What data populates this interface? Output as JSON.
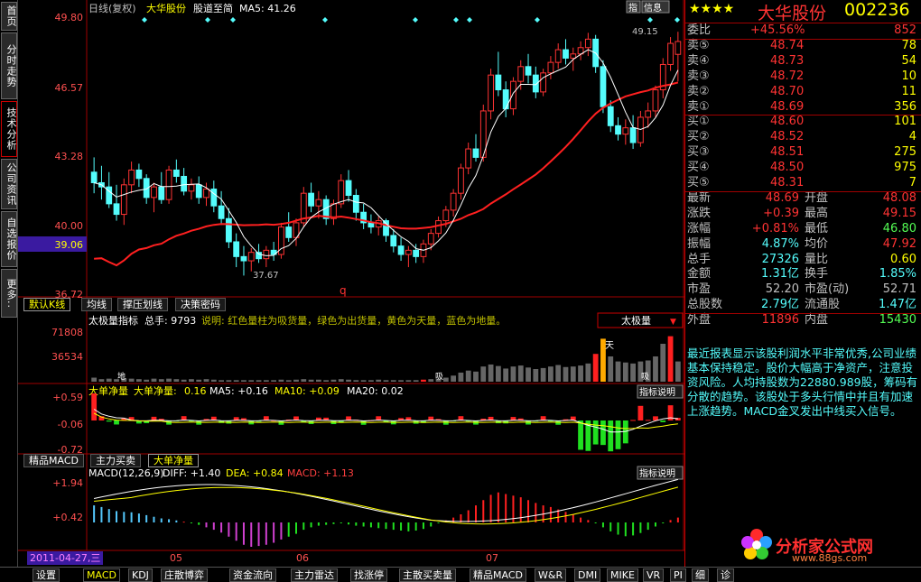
{
  "left_tabs": [
    "首页",
    "分时走势",
    "技术分析",
    "公司资讯",
    "自选报价",
    "更多.."
  ],
  "header": {
    "period": "日线(复权)",
    "stock_name": "大华股份",
    "formula": "股道至简",
    "ma_label": "MA5: 41.26",
    "icon_zhi": "指",
    "icon_info": "信息"
  },
  "main_axis": {
    "labels": [
      "49.80",
      "46.57",
      "43.28",
      "40.00",
      "36.72"
    ],
    "current_price_badge": "39.06",
    "high_label": "49.15",
    "low_label": "37.67",
    "marker_q": "q"
  },
  "upper_subtabs": [
    "默认K线",
    "均线",
    "撑压划线",
    "决策密码"
  ],
  "vol_panel": {
    "title": "太极量指标",
    "total_label": "总手: 9793",
    "desc": "说明: 红色量柱为吸货量，绿色为出货量，黄色为天量，蓝色为地量。",
    "dropdown": "太极量",
    "axis": [
      "71808",
      "36534"
    ],
    "marker_di": "地",
    "marker_tian": "天",
    "marker_x1": "吸",
    "marker_x2": "吸"
  },
  "net_panel": {
    "name1": "大单净量",
    "name2": "大单净量:",
    "val": "0.16",
    "ma5": "MA5: +0.16",
    "ma10": "MA10: +0.09",
    "ma20": "MA20: 0.02",
    "btn": "指标说明",
    "axis": [
      "+0.59",
      "-0.06",
      "-0.72"
    ]
  },
  "middle_subtabs": [
    "精品MACD",
    "主力买卖",
    "大单净量"
  ],
  "macd_panel": {
    "name": "MACD(12,26,9)",
    "diff": "DIFF: +1.40",
    "dea": "DEA: +0.84",
    "macd": "MACD: +1.13",
    "btn": "指标说明",
    "axis": [
      "+1.94",
      "+0.42"
    ]
  },
  "date_axis": {
    "date_badge": "2011-04-27,三",
    "months": [
      "05",
      "06",
      "07"
    ]
  },
  "quote": {
    "stars": "★★★★",
    "title": "大华股份",
    "code": "002236",
    "weibi": {
      "label": "委比",
      "pct": "+45.56%",
      "val": "852"
    },
    "sells": [
      {
        "label": "卖⑤",
        "price": "48.74",
        "vol": "78"
      },
      {
        "label": "卖④",
        "price": "48.73",
        "vol": "54"
      },
      {
        "label": "卖③",
        "price": "48.72",
        "vol": "10"
      },
      {
        "label": "卖②",
        "price": "48.70",
        "vol": "11"
      },
      {
        "label": "卖①",
        "price": "48.69",
        "vol": "356"
      }
    ],
    "buys": [
      {
        "label": "买①",
        "price": "48.60",
        "vol": "101"
      },
      {
        "label": "买②",
        "price": "48.52",
        "vol": "4"
      },
      {
        "label": "买③",
        "price": "48.51",
        "vol": "275"
      },
      {
        "label": "买④",
        "price": "48.50",
        "vol": "975"
      },
      {
        "label": "买⑤",
        "price": "48.31",
        "vol": "7"
      }
    ],
    "stats": [
      {
        "l1": "最新",
        "v1": "48.69",
        "l2": "开盘",
        "v2": "48.08"
      },
      {
        "l1": "涨跌",
        "v1": "+0.39",
        "l2": "最高",
        "v2": "49.15"
      },
      {
        "l1": "涨幅",
        "v1": "+0.81%",
        "l2": "最低",
        "v2": "46.80"
      },
      {
        "l1": "振幅",
        "v1": "4.87%",
        "l2": "均价",
        "v2": "47.92"
      },
      {
        "l1": "总手",
        "v1": "27326",
        "l2": "量比",
        "v2": "0.60"
      },
      {
        "l1": "金额",
        "v1": "1.31亿",
        "l2": "换手",
        "v2": "1.85%"
      },
      {
        "l1": "市盈",
        "v1": "52.20",
        "l2": "市盈(动)",
        "v2": "52.71"
      },
      {
        "l1": "总股数",
        "v1": "2.79亿",
        "l2": "流通股",
        "v2": "1.47亿"
      },
      {
        "l1": "外盘",
        "v1": "11896",
        "l2": "内盘",
        "v2": "15430"
      }
    ],
    "analysis": "最近报表显示该股利润水平非常优秀,公司业绩基本保持稳定。股价大幅高于净资产，注意投资风险。人均持股数为22880.989股，筹码有分散的趋势。该股处于多头行情中并且有加速上涨趋势。MACD金叉发出中线买入信号。"
  },
  "logo": {
    "text": "分析家公式网",
    "url_text": "www.88gs.com"
  },
  "bottom_tabs": [
    "设置",
    "MACD",
    "KDJ",
    "庄散博弈",
    "资金流向",
    "主力雷达",
    "找涨停",
    "主散买卖量",
    "精品MACD",
    "W&R",
    "DMI",
    "MIKE",
    "VR",
    "PI",
    "细",
    "诊"
  ],
  "colors": {
    "up": "#ff3333",
    "down": "#54fcfc",
    "ma_white": "#ffffff",
    "ma_red": "#ff2020",
    "ma_blue": "#2040ff",
    "axis_red": "#a00000",
    "yellow": "#ffff00"
  },
  "chart_data": {
    "type": "candlestick",
    "y_range": [
      36.72,
      49.8
    ],
    "candles": [
      [
        42.5,
        43.2,
        41.5,
        42.0
      ],
      [
        42.0,
        42.8,
        41.2,
        41.8
      ],
      [
        41.8,
        42.5,
        40.8,
        41.0
      ],
      [
        41.0,
        41.9,
        40.2,
        40.5
      ],
      [
        40.5,
        42.2,
        40.0,
        41.9
      ],
      [
        41.9,
        43.0,
        41.5,
        42.6
      ],
      [
        42.6,
        42.9,
        41.8,
        42.2
      ],
      [
        42.2,
        42.4,
        41.0,
        41.3
      ],
      [
        41.3,
        42.0,
        40.6,
        41.8
      ],
      [
        41.8,
        42.5,
        41.0,
        41.2
      ],
      [
        41.2,
        42.8,
        41.0,
        42.6
      ],
      [
        42.6,
        43.1,
        42.0,
        42.3
      ],
      [
        42.3,
        42.7,
        41.4,
        41.6
      ],
      [
        41.6,
        42.2,
        41.2,
        41.9
      ],
      [
        41.9,
        42.3,
        41.0,
        41.3
      ],
      [
        41.3,
        42.0,
        40.9,
        41.7
      ],
      [
        41.7,
        42.1,
        40.6,
        40.9
      ],
      [
        40.9,
        41.6,
        40.0,
        40.3
      ],
      [
        40.3,
        40.8,
        38.9,
        39.2
      ],
      [
        39.2,
        39.6,
        38.0,
        38.5
      ],
      [
        38.5,
        39.0,
        37.6,
        38.3
      ],
      [
        38.3,
        38.9,
        37.8,
        38.7
      ],
      [
        38.7,
        39.1,
        38.2,
        38.4
      ],
      [
        38.4,
        39.0,
        38.0,
        38.8
      ],
      [
        38.8,
        39.2,
        38.3,
        38.6
      ],
      [
        38.6,
        40.1,
        38.4,
        39.9
      ],
      [
        39.9,
        40.6,
        39.2,
        39.4
      ],
      [
        39.4,
        40.3,
        39.0,
        40.1
      ],
      [
        40.1,
        41.8,
        39.9,
        41.5
      ],
      [
        41.5,
        42.0,
        40.6,
        40.9
      ],
      [
        40.9,
        41.6,
        40.3,
        41.2
      ],
      [
        41.2,
        41.4,
        40.0,
        40.3
      ],
      [
        40.3,
        41.2,
        40.0,
        41.0
      ],
      [
        41.0,
        42.4,
        40.8,
        42.1
      ],
      [
        42.1,
        42.6,
        41.1,
        41.4
      ],
      [
        41.4,
        41.7,
        40.2,
        40.6
      ],
      [
        40.6,
        41.0,
        39.8,
        40.1
      ],
      [
        40.1,
        40.5,
        39.6,
        39.9
      ],
      [
        39.9,
        40.4,
        39.5,
        40.2
      ],
      [
        40.2,
        40.3,
        39.2,
        39.5
      ],
      [
        39.5,
        39.8,
        38.7,
        39.0
      ],
      [
        39.0,
        39.4,
        38.3,
        38.6
      ],
      [
        38.6,
        39.0,
        38.0,
        38.8
      ],
      [
        38.8,
        39.1,
        38.2,
        38.5
      ],
      [
        38.5,
        39.3,
        38.2,
        39.1
      ],
      [
        39.1,
        39.8,
        38.8,
        39.6
      ],
      [
        39.6,
        40.4,
        39.4,
        40.2
      ],
      [
        40.2,
        40.9,
        39.9,
        40.7
      ],
      [
        40.7,
        41.7,
        40.4,
        41.5
      ],
      [
        41.5,
        42.9,
        41.2,
        42.7
      ],
      [
        42.7,
        43.9,
        42.4,
        43.6
      ],
      [
        43.6,
        44.3,
        43.0,
        43.2
      ],
      [
        43.2,
        45.7,
        43.0,
        45.4
      ],
      [
        45.4,
        47.4,
        45.0,
        47.1
      ],
      [
        47.1,
        48.2,
        46.1,
        46.4
      ],
      [
        46.4,
        46.8,
        45.1,
        45.5
      ],
      [
        45.5,
        47.0,
        45.2,
        46.8
      ],
      [
        46.8,
        47.8,
        46.4,
        47.5
      ],
      [
        47.5,
        48.1,
        46.7,
        47.1
      ],
      [
        47.1,
        47.5,
        46.0,
        46.3
      ],
      [
        46.3,
        47.4,
        46.1,
        47.2
      ],
      [
        47.2,
        48.0,
        46.9,
        47.7
      ],
      [
        47.7,
        48.6,
        47.4,
        48.3
      ],
      [
        48.3,
        48.8,
        47.6,
        47.9
      ],
      [
        47.9,
        48.4,
        47.3,
        48.1
      ],
      [
        48.1,
        48.7,
        47.8,
        48.4
      ],
      [
        48.4,
        49.1,
        48.0,
        48.8
      ],
      [
        48.8,
        49.0,
        47.2,
        47.5
      ],
      [
        47.5,
        47.8,
        45.3,
        45.6
      ],
      [
        45.6,
        45.9,
        44.4,
        44.7
      ],
      [
        44.7,
        45.1,
        44.0,
        44.3
      ],
      [
        44.3,
        45.0,
        43.8,
        44.6
      ],
      [
        44.6,
        45.2,
        43.6,
        43.9
      ],
      [
        43.9,
        45.4,
        43.7,
        45.1
      ],
      [
        45.1,
        45.8,
        44.6,
        45.4
      ],
      [
        45.4,
        46.6,
        45.1,
        46.4
      ],
      [
        46.4,
        47.9,
        46.0,
        47.6
      ],
      [
        47.6,
        48.9,
        47.3,
        48.6
      ],
      [
        48.08,
        49.15,
        46.8,
        48.69
      ]
    ],
    "volume_max": 71808,
    "volume": [
      0.08,
      0.05,
      0.06,
      0.05,
      0.07,
      0.06,
      0.05,
      0.04,
      0.06,
      0.05,
      0.06,
      0.05,
      0.04,
      0.05,
      0.04,
      0.05,
      0.04,
      0.03,
      0.03,
      0.03,
      0.03,
      0.03,
      0.03,
      0.03,
      0.03,
      0.04,
      0.03,
      0.04,
      0.05,
      0.04,
      0.04,
      0.03,
      0.04,
      0.05,
      0.04,
      0.03,
      0.03,
      0.03,
      0.04,
      0.03,
      0.03,
      0.03,
      0.03,
      0.03,
      0.04,
      0.05,
      0.06,
      0.08,
      0.12,
      0.18,
      0.22,
      0.2,
      0.3,
      0.34,
      0.31,
      0.26,
      0.3,
      0.32,
      0.28,
      0.25,
      0.27,
      0.3,
      0.33,
      0.29,
      0.3,
      0.32,
      0.36,
      0.55,
      0.85,
      0.5,
      0.4,
      0.38,
      0.36,
      0.4,
      0.42,
      0.5,
      0.75,
      0.9,
      0.4
    ],
    "macd_hist": [
      0.42,
      0.38,
      0.33,
      0.28,
      0.26,
      0.25,
      0.22,
      0.18,
      0.14,
      0.1,
      0.08,
      0.05,
      0.02,
      -0.02,
      -0.06,
      -0.12,
      -0.18,
      -0.25,
      -0.35,
      -0.45,
      -0.55,
      -0.6,
      -0.58,
      -0.55,
      -0.5,
      -0.42,
      -0.35,
      -0.28,
      -0.18,
      -0.12,
      -0.08,
      -0.06,
      -0.04,
      -0.02,
      -0.05,
      -0.08,
      -0.1,
      -0.12,
      -0.14,
      -0.16,
      -0.18,
      -0.2,
      -0.22,
      -0.2,
      -0.16,
      -0.1,
      -0.02,
      0.05,
      0.12,
      0.2,
      0.3,
      0.42,
      0.55,
      0.68,
      0.74,
      0.7,
      0.66,
      0.62,
      0.55,
      0.48,
      0.42,
      0.38,
      0.32,
      0.26,
      0.2,
      0.12,
      0.06,
      -0.02,
      -0.12,
      -0.22,
      -0.3,
      -0.34,
      -0.32,
      -0.26,
      -0.18,
      -0.1,
      -0.02,
      0.06,
      0.12
    ]
  }
}
